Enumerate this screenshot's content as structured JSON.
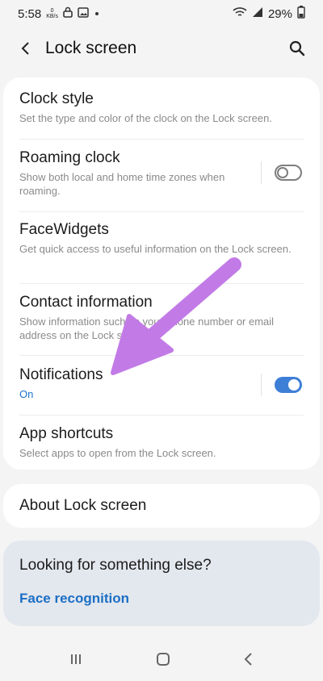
{
  "status_bar": {
    "time": "5:58",
    "speed_value": "0",
    "speed_unit": "KB/s",
    "battery": "29%"
  },
  "app_bar": {
    "title": "Lock screen"
  },
  "settings": [
    {
      "title": "Clock style",
      "subtitle": "Set the type and color of the clock on the Lock screen."
    },
    {
      "title": "Roaming clock",
      "subtitle": "Show both local and home time zones when roaming.",
      "toggle": false
    },
    {
      "title": "FaceWidgets",
      "subtitle": "Get quick access to useful information on the Lock screen."
    },
    {
      "title": "Contact information",
      "subtitle": "Show information such as your phone number or email address on the Lock screen."
    },
    {
      "title": "Notifications",
      "subtitle": "On",
      "toggle": true
    },
    {
      "title": "App shortcuts",
      "subtitle": "Select apps to open from the Lock screen."
    }
  ],
  "about": {
    "title": "About Lock screen"
  },
  "looking": {
    "title": "Looking for something else?",
    "link": "Face recognition"
  },
  "colors": {
    "accent": "#3d7fd6",
    "link": "#1b6fc4",
    "annotation_arrow": "#c27be6"
  },
  "icons": {
    "back": "chevron-left-icon",
    "search": "search-icon",
    "recents": "recents-icon",
    "home": "home-icon",
    "nav_back": "nav-back-icon"
  }
}
